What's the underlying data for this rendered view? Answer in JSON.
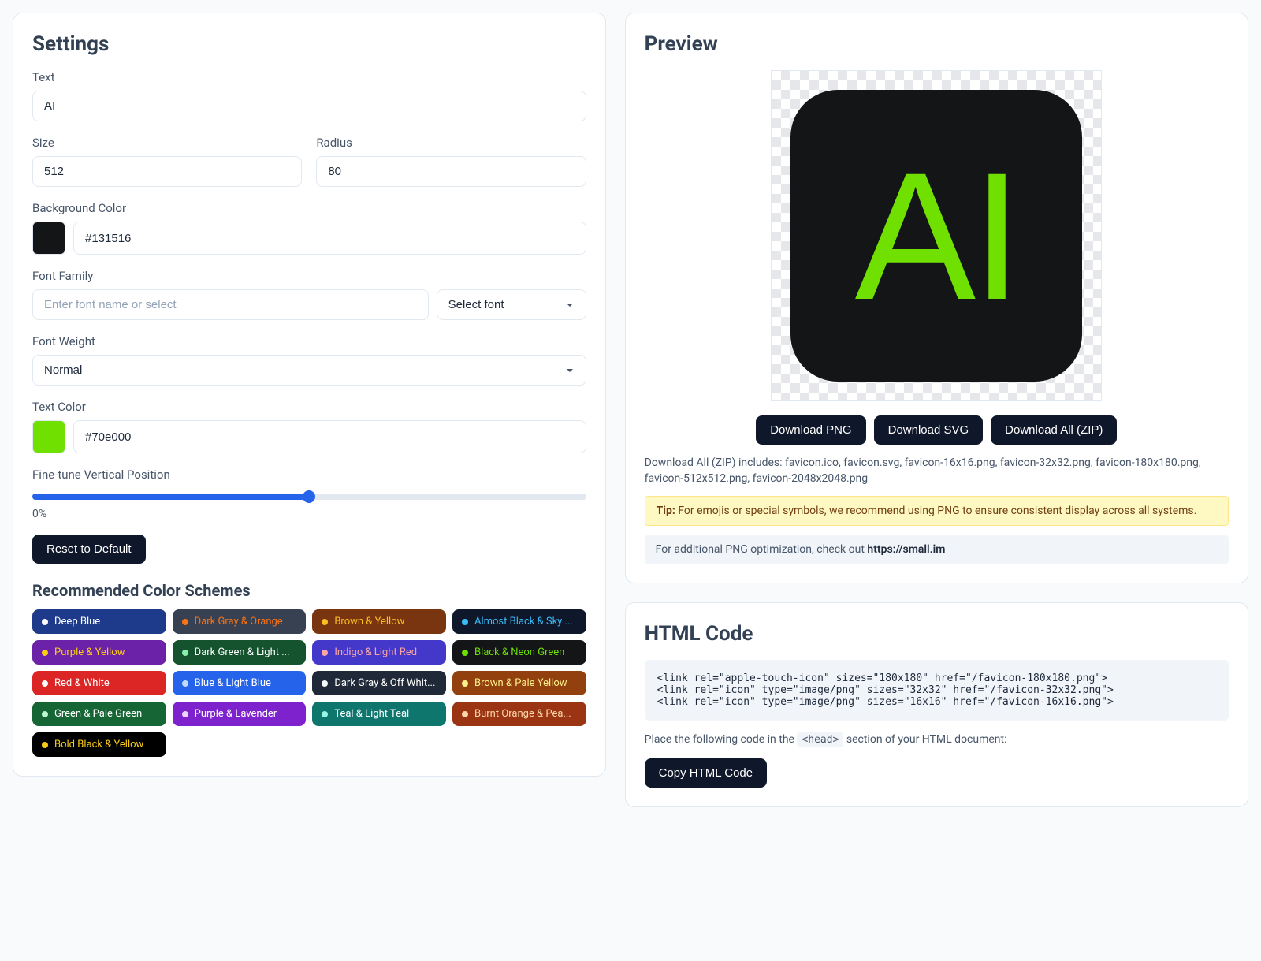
{
  "settings": {
    "title": "Settings",
    "text_label": "Text",
    "text_value": "AI",
    "size_label": "Size",
    "size_value": "512",
    "radius_label": "Radius",
    "radius_value": "80",
    "bg_label": "Background Color",
    "bg_value": "#131516",
    "font_family_label": "Font Family",
    "font_family_placeholder": "Enter font name or select",
    "font_family_select": "Select font",
    "font_weight_label": "Font Weight",
    "font_weight_value": "Normal",
    "text_color_label": "Text Color",
    "text_color_value": "#70e000",
    "vpos_label": "Fine-tune Vertical Position",
    "vpos_value": "0%",
    "reset_label": "Reset to Default",
    "schemes_title": "Recommended Color Schemes",
    "schemes": [
      {
        "label": "Deep Blue",
        "bg": "#1e3a8a",
        "dot": "#ffffff",
        "fg": "#ffffff"
      },
      {
        "label": "Dark Gray & Orange",
        "bg": "#374151",
        "dot": "#f97316",
        "fg": "#f97316"
      },
      {
        "label": "Brown & Yellow",
        "bg": "#78350f",
        "dot": "#fbbf24",
        "fg": "#fbbf24"
      },
      {
        "label": "Almost Black & Sky ...",
        "bg": "#0f172a",
        "dot": "#38bdf8",
        "fg": "#38bdf8"
      },
      {
        "label": "Purple & Yellow",
        "bg": "#6b21a8",
        "dot": "#facc15",
        "fg": "#facc15"
      },
      {
        "label": "Dark Green & Light ...",
        "bg": "#14532d",
        "dot": "#86efac",
        "fg": "#ffffff"
      },
      {
        "label": "Indigo & Light Red",
        "bg": "#4338ca",
        "dot": "#fca5a5",
        "fg": "#fca5a5"
      },
      {
        "label": "Black & Neon Green",
        "bg": "#131516",
        "dot": "#70e000",
        "fg": "#70e000"
      },
      {
        "label": "Red & White",
        "bg": "#dc2626",
        "dot": "#ffffff",
        "fg": "#ffffff"
      },
      {
        "label": "Blue & Light Blue",
        "bg": "#2563eb",
        "dot": "#bfdbfe",
        "fg": "#ffffff"
      },
      {
        "label": "Dark Gray & Off Whit...",
        "bg": "#1f2937",
        "dot": "#f9fafb",
        "fg": "#ffffff"
      },
      {
        "label": "Brown & Pale Yellow",
        "bg": "#92400e",
        "dot": "#fef08a",
        "fg": "#fef08a"
      },
      {
        "label": "Green & Pale Green",
        "bg": "#166534",
        "dot": "#bbf7d0",
        "fg": "#ffffff"
      },
      {
        "label": "Purple & Lavender",
        "bg": "#7e22ce",
        "dot": "#e9d5ff",
        "fg": "#ffffff"
      },
      {
        "label": "Teal & Light Teal",
        "bg": "#0f766e",
        "dot": "#99f6e4",
        "fg": "#ffffff"
      },
      {
        "label": "Burnt Orange & Pea...",
        "bg": "#9a3412",
        "dot": "#fed7aa",
        "fg": "#fed7aa"
      },
      {
        "label": "Bold Black & Yellow",
        "bg": "#000000",
        "dot": "#facc15",
        "fg": "#facc15"
      }
    ]
  },
  "preview": {
    "title": "Preview",
    "dl_png": "Download PNG",
    "dl_svg": "Download SVG",
    "dl_zip": "Download All (ZIP)",
    "zip_note": "Download All (ZIP) includes: favicon.ico, favicon.svg, favicon-16x16.png, favicon-32x32.png, favicon-180x180.png, favicon-512x512.png, favicon-2048x2048.png",
    "tip_prefix": "Tip:",
    "tip_text": "For emojis or special symbols, we recommend using PNG to ensure consistent display across all systems.",
    "opt_prefix": "For additional PNG optimization, check out ",
    "opt_link": "https://small.im"
  },
  "htmlcode": {
    "title": "HTML Code",
    "code": "<link rel=\"apple-touch-icon\" sizes=\"180x180\" href=\"/favicon-180x180.png\">\n<link rel=\"icon\" type=\"image/png\" sizes=\"32x32\" href=\"/favicon-32x32.png\">\n<link rel=\"icon\" type=\"image/png\" sizes=\"16x16\" href=\"/favicon-16x16.png\">",
    "note_prefix": "Place the following code in the ",
    "note_tag": "<head>",
    "note_suffix": " section of your HTML document:",
    "copy_label": "Copy HTML Code"
  }
}
